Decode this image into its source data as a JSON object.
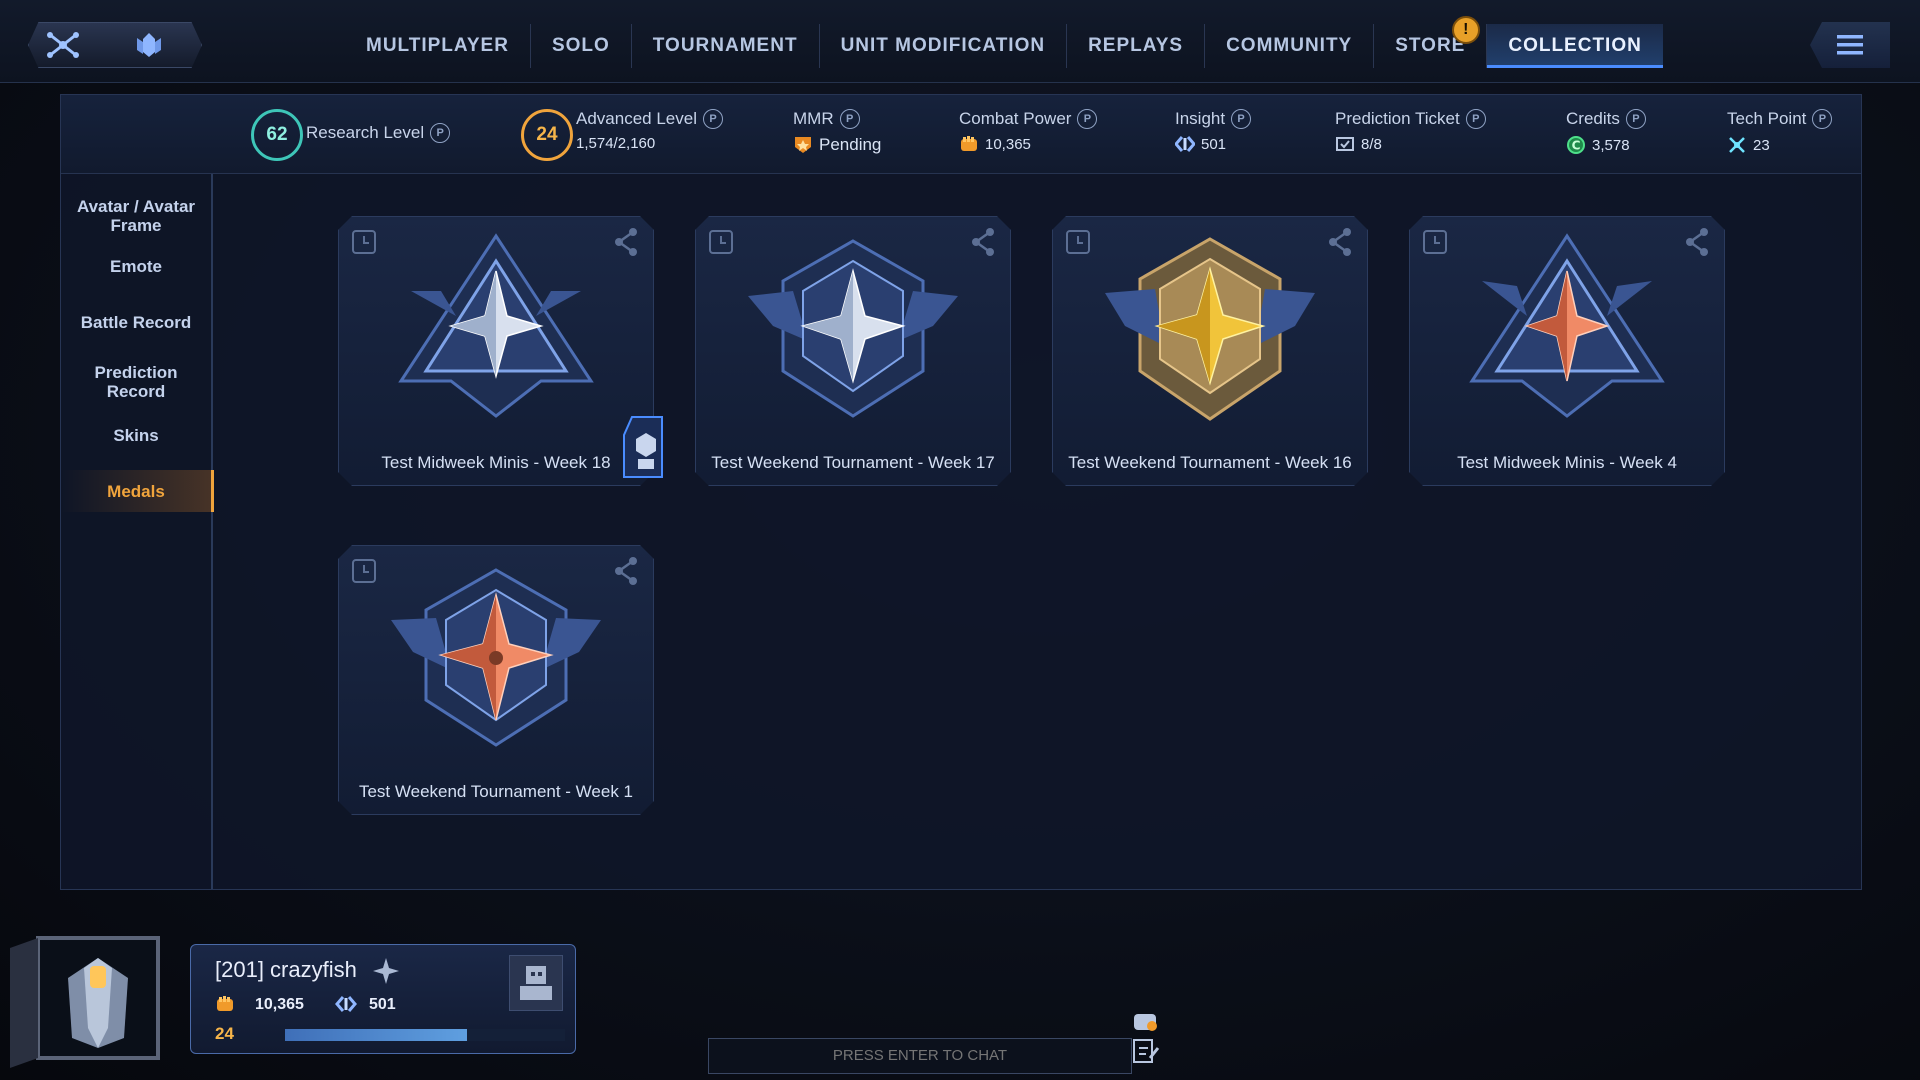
{
  "nav": {
    "tabs": [
      {
        "label": "MULTIPLAYER",
        "active": false
      },
      {
        "label": "SOLO",
        "active": false
      },
      {
        "label": "TOURNAMENT",
        "active": false
      },
      {
        "label": "UNIT MODIFICATION",
        "active": false
      },
      {
        "label": "REPLAYS",
        "active": false
      },
      {
        "label": "COMMUNITY",
        "active": false
      },
      {
        "label": "STORE",
        "active": false,
        "badge": "!"
      },
      {
        "label": "COLLECTION",
        "active": true
      }
    ],
    "left_icons": [
      "network-icon",
      "guardian-icon"
    ],
    "menu_icon": "hamburger-menu-icon"
  },
  "stats": {
    "research_level": {
      "label": "Research Level",
      "value": "62"
    },
    "advanced_level": {
      "label": "Advanced Level",
      "level": "24",
      "progress": "1,574/2,160",
      "progress_fraction": 0.7287
    },
    "mmr": {
      "label": "MMR",
      "value": "Pending"
    },
    "combat_power": {
      "label": "Combat Power",
      "value": "10,365"
    },
    "insight": {
      "label": "Insight",
      "value": "501"
    },
    "prediction_ticket": {
      "label": "Prediction Ticket",
      "value": "8/8"
    },
    "credits": {
      "label": "Credits",
      "value": "3,578"
    },
    "tech_point": {
      "label": "Tech Point",
      "value": "23"
    },
    "help_glyph": "P"
  },
  "sidebar": {
    "items": [
      {
        "label": "Avatar / Avatar Frame",
        "active": false
      },
      {
        "label": "Emote",
        "active": false
      },
      {
        "label": "Battle Record",
        "active": false
      },
      {
        "label": "Prediction Record",
        "active": false
      },
      {
        "label": "Skins",
        "active": false
      },
      {
        "label": "Medals",
        "active": true
      }
    ]
  },
  "medals": [
    {
      "title": "Test Midweek Minis - Week 18",
      "style": "silver-triangle",
      "equipped": true
    },
    {
      "title": "Test Weekend Tournament - Week 17",
      "style": "silver-winged"
    },
    {
      "title": "Test Weekend Tournament - Week 16",
      "style": "gold-winged"
    },
    {
      "title": "Test Midweek Minis - Week 4",
      "style": "copper-triangle"
    },
    {
      "title": "Test Weekend Tournament - Week 1",
      "style": "copper-winged"
    }
  ],
  "player": {
    "name": "[201] crazyfish",
    "combat_power": "10,365",
    "insight": "501",
    "level": "24",
    "xp_fraction": 0.65
  },
  "chat": {
    "placeholder": "PRESS ENTER TO CHAT"
  },
  "colors": {
    "accent": "#4a8cff",
    "active_side": "#f0a43c",
    "gold": "#e9b42a",
    "silver": "#c9d3e4",
    "copper": "#e07a56"
  }
}
